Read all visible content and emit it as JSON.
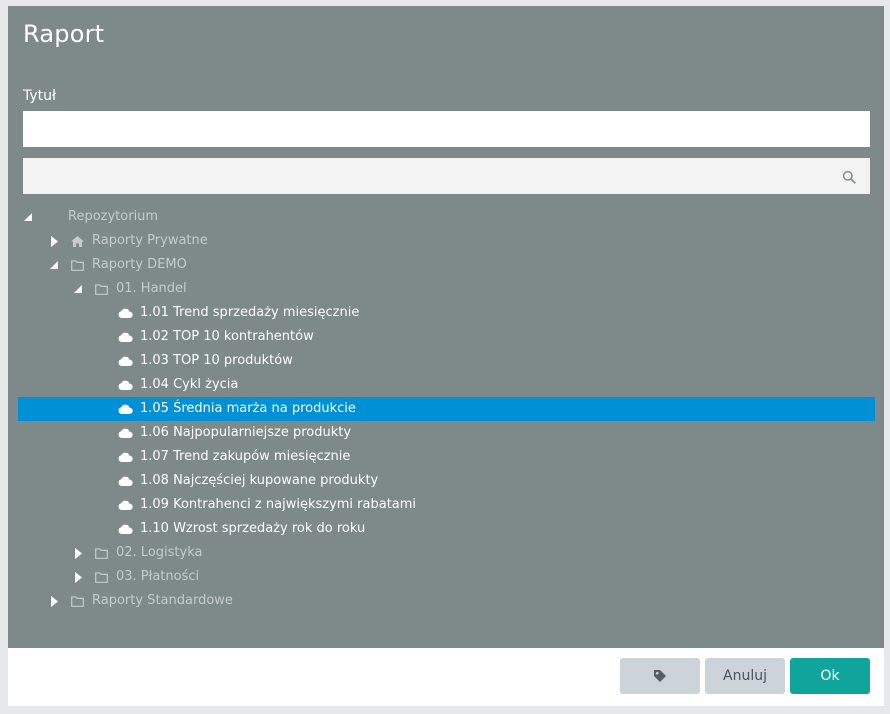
{
  "dialog": {
    "title": "Raport",
    "title_field_label": "Tytuł",
    "title_field_value": "",
    "search_placeholder": ""
  },
  "tree": {
    "root": "Repozytorium",
    "private_reports": "Raporty Prywatne",
    "demo_reports": "Raporty DEMO",
    "handel": "01. Handel",
    "reports": [
      "1.01 Trend sprzedaży miesięcznie",
      "1.02 TOP 10 kontrahentów",
      "1.03 TOP 10 produktów",
      "1.04 Cykl życia",
      "1.05 Średnia marża na produkcie",
      "1.06 Najpopularniejsze produkty",
      "1.07 Trend zakupów miesięcznie",
      "1.08 Najczęściej kupowane produkty",
      "1.09 Kontrahenci z największymi rabatami",
      "1.10 Wzrost sprzedaży rok do roku"
    ],
    "selected_report": "1.05 Średnia marża na produkcie",
    "logistyka": "02. Logistyka",
    "platnosci": "03. Płatności",
    "standard_reports": "Raporty Standardowe"
  },
  "footer": {
    "tag_icon": "tag-icon",
    "cancel_label": "Anuluj",
    "ok_label": "Ok"
  },
  "colors": {
    "dialog_bg": "#7d8a89",
    "selected_bg": "#0090d6",
    "ok_button": "#10a59c",
    "secondary_button": "#ccd3d9"
  }
}
